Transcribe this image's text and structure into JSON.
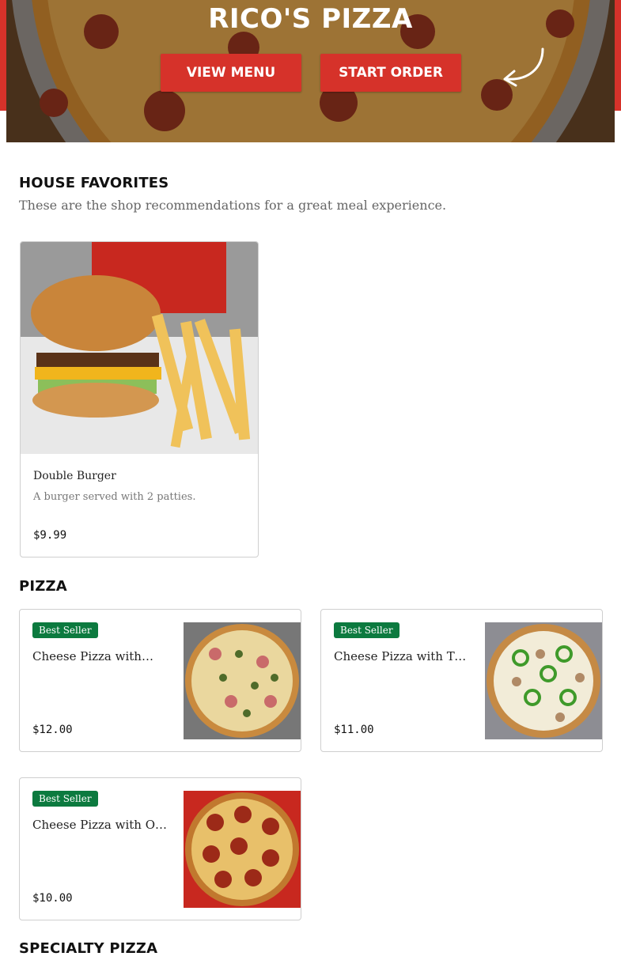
{
  "hero": {
    "title": "RICO'S PIZZA",
    "view_menu_label": "VIEW MENU",
    "start_order_label": "START ORDER"
  },
  "house_favorites": {
    "title": "HOUSE FAVORITES",
    "subtitle": "These are the shop recommendations for a great meal experience.",
    "items": [
      {
        "name": "Double Burger",
        "description": "A burger served with 2 patties.",
        "price": "$9.99",
        "image": "burger-and-fries-photo"
      }
    ]
  },
  "pizza": {
    "title": "PIZZA",
    "items": [
      {
        "badge": "Best Seller",
        "name": "Cheese Pizza with…",
        "price": "$12.00",
        "image": "pizza-ham-jalapeno-photo"
      },
      {
        "badge": "Best Seller",
        "name": "Cheese Pizza with Tw…",
        "price": "$11.00",
        "image": "pizza-chicken-green-pepper-photo"
      },
      {
        "badge": "Best Seller",
        "name": "Cheese Pizza with On…",
        "price": "$10.00",
        "image": "pizza-pepperoni-photo"
      }
    ]
  },
  "specialty_pizza": {
    "title": "SPECIALTY PIZZA"
  },
  "colors": {
    "brand_red": "#d6322a",
    "badge_green": "#0c7a3f"
  }
}
